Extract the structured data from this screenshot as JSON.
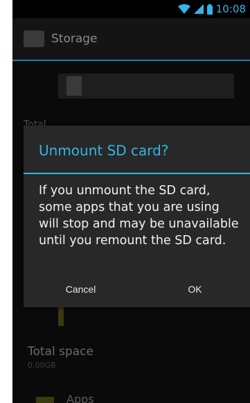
{
  "status_bar": {
    "time": "10:08",
    "icons": [
      "wifi-icon",
      "signal-icon",
      "battery-icon"
    ],
    "accent_color": "#33b5e5"
  },
  "action_bar": {
    "title": "Storage",
    "icon": "storage-app-icon"
  },
  "background": {
    "section_label": "Total",
    "total_space_label": "Total space",
    "total_space_value": "0.00GB",
    "apps_label": "Apps"
  },
  "dialog": {
    "title": "Unmount SD card?",
    "message": "If you unmount the SD card, some apps that you are using will stop and may be unavailable until you remount the SD card.",
    "cancel_label": "Cancel",
    "ok_label": "OK",
    "title_color": "#33b5e5"
  }
}
